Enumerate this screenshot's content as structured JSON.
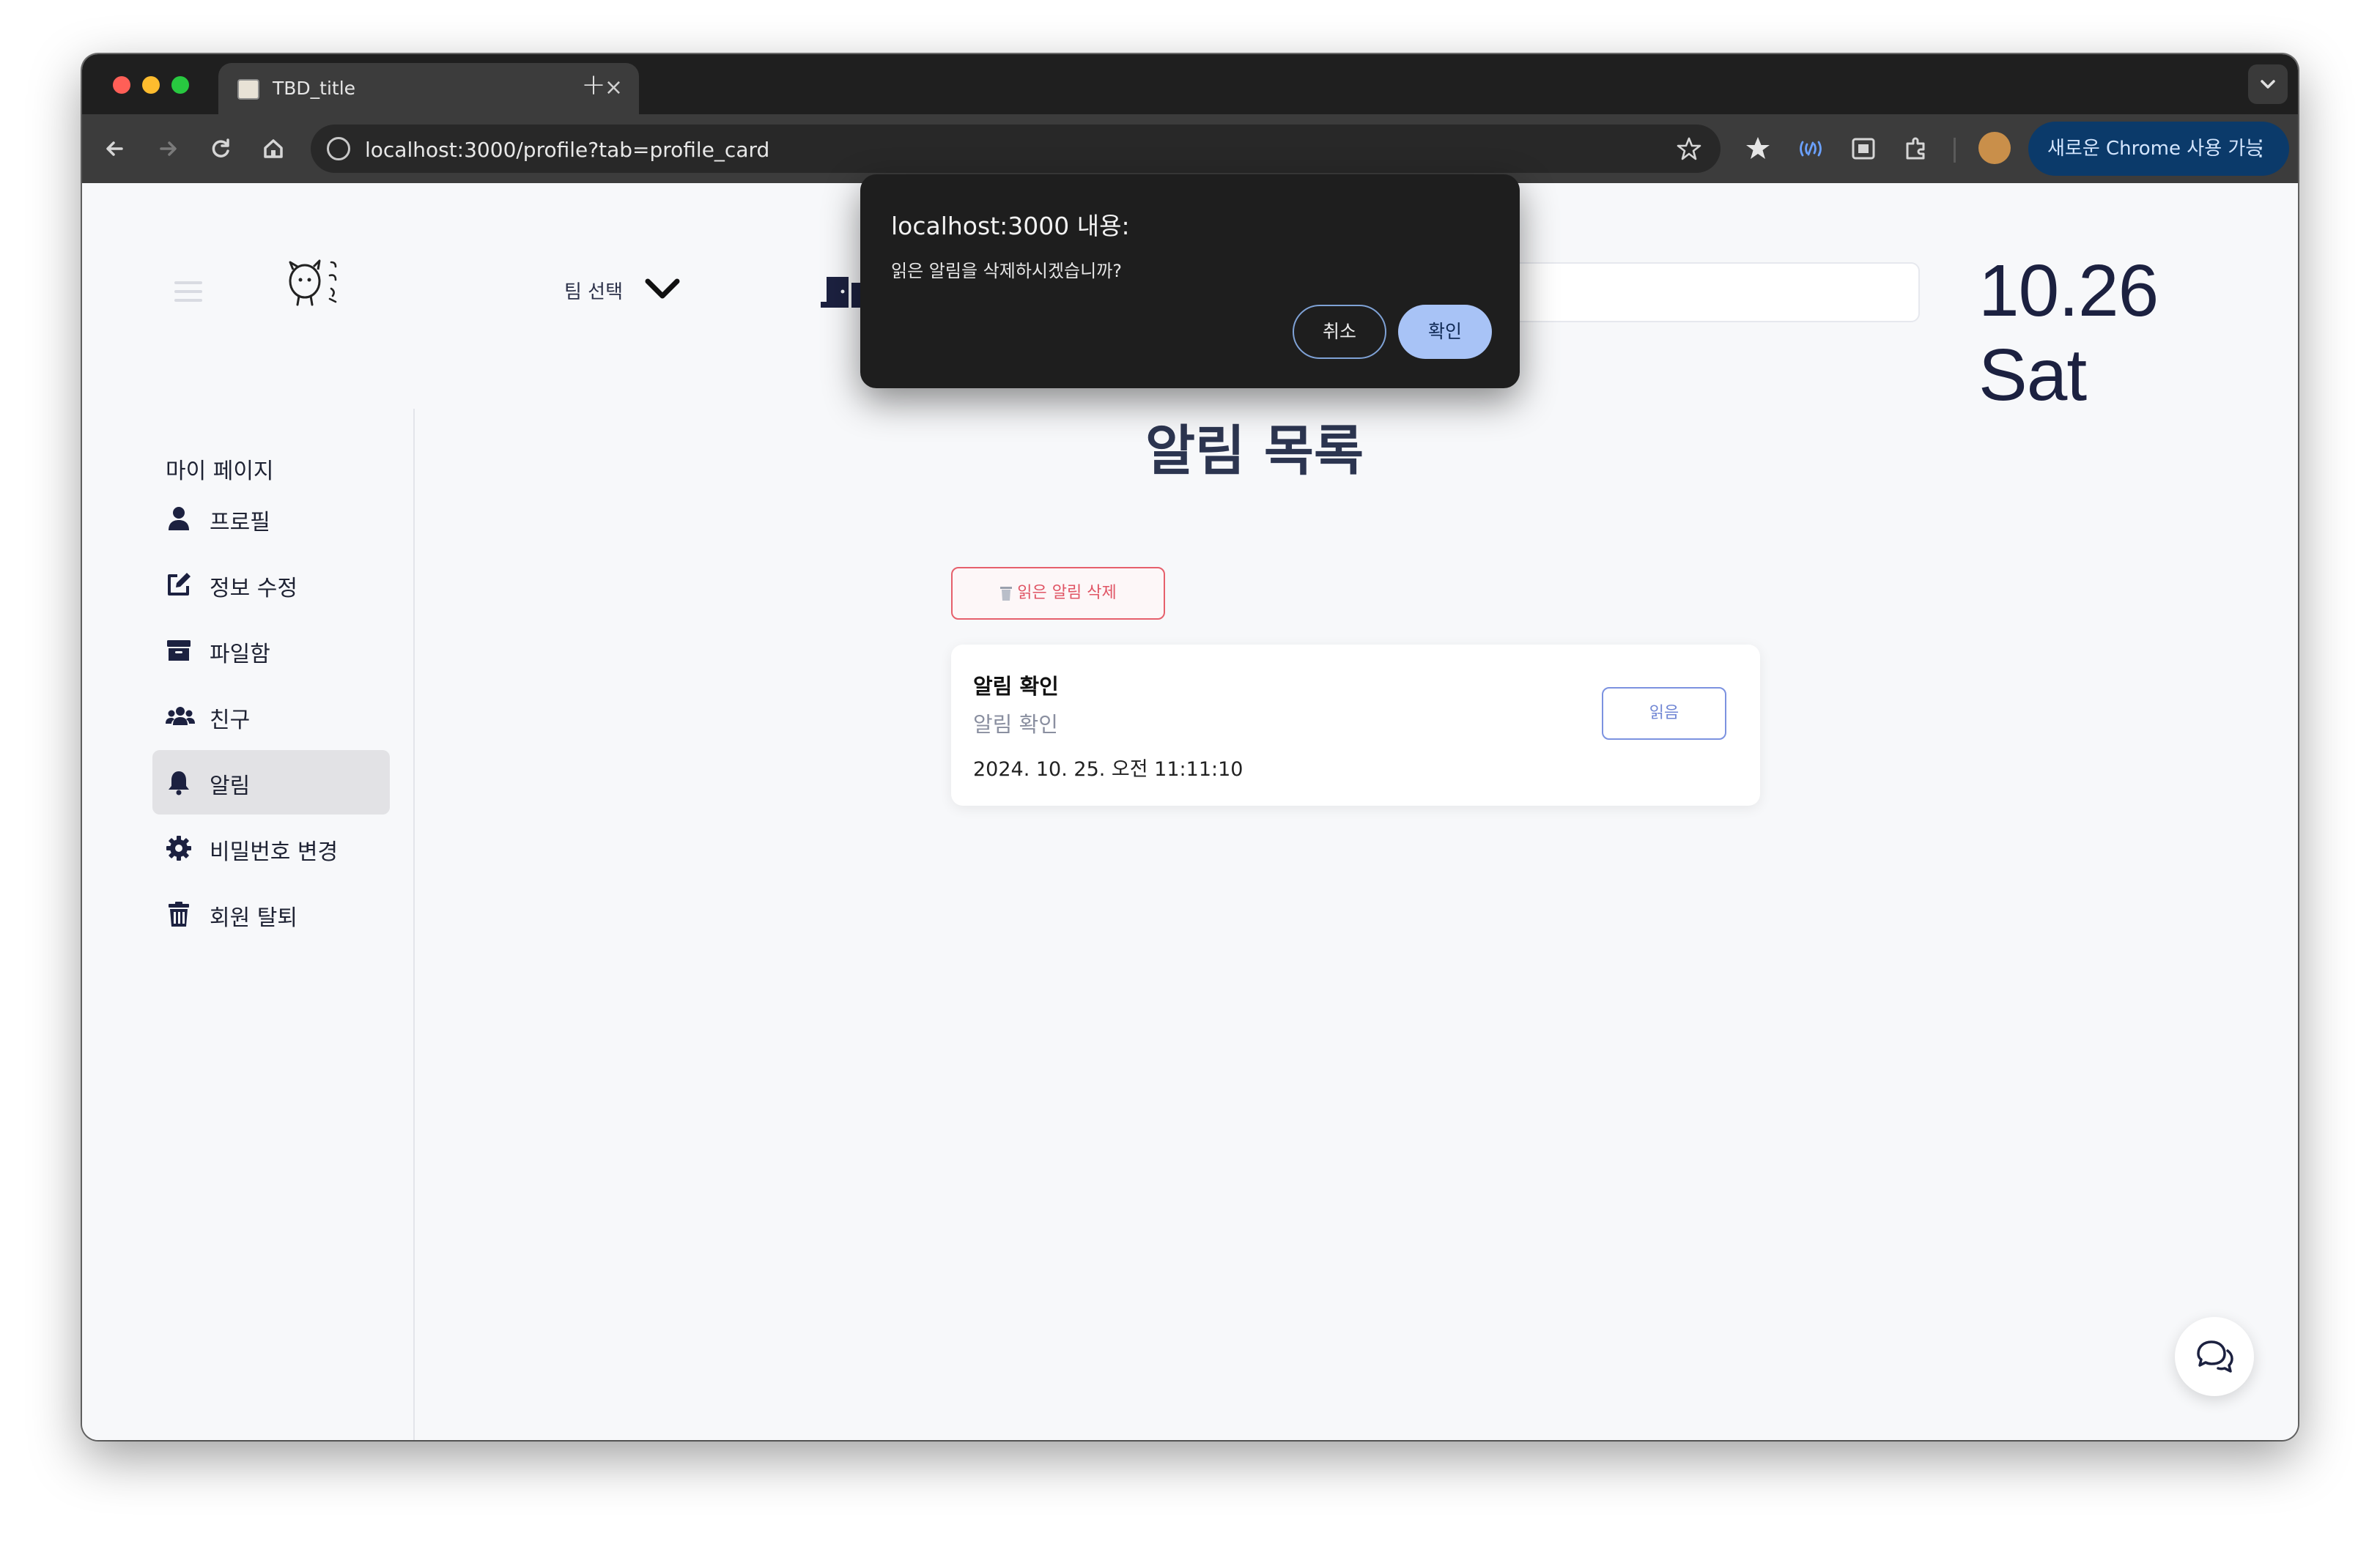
{
  "browser": {
    "tab_title": "TBD_title",
    "tab_close": "×",
    "new_tab": "+",
    "url": "localhost:3000/profile?tab=profile_card",
    "update_button": "새로운 Chrome 사용 가능",
    "update_menu": "⋮"
  },
  "header": {
    "team_select_label": "팀 선택",
    "date": "10.26 Sat"
  },
  "sidebar": {
    "title": "마이 페이지",
    "items": [
      {
        "label": "프로필",
        "icon": "user-icon"
      },
      {
        "label": "정보 수정",
        "icon": "edit-icon"
      },
      {
        "label": "파일함",
        "icon": "archive-icon"
      },
      {
        "label": "친구",
        "icon": "users-icon"
      },
      {
        "label": "알림",
        "icon": "bell-icon",
        "active": true
      },
      {
        "label": "비밀번호 변경",
        "icon": "gear-icon"
      },
      {
        "label": "회원 탈퇴",
        "icon": "trash-icon"
      }
    ]
  },
  "main": {
    "title": "알림 목록",
    "delete_read_label": "읽은 알림 삭제",
    "notifications": [
      {
        "title": "알림 확인",
        "subtitle": "알림 확인",
        "time": "2024. 10. 25. 오전 11:11:10",
        "read_label": "읽음"
      }
    ]
  },
  "dialog": {
    "title": "localhost:3000 내용:",
    "message": "읽은 알림을 삭제하시겠습니까?",
    "cancel_label": "취소",
    "ok_label": "확인"
  },
  "colors": {
    "accent": "#a8c3f6",
    "danger": "#e05565",
    "read_button": "#7086d4",
    "sidebar_active": "#e2e2e5",
    "title_text": "#2c3550"
  }
}
